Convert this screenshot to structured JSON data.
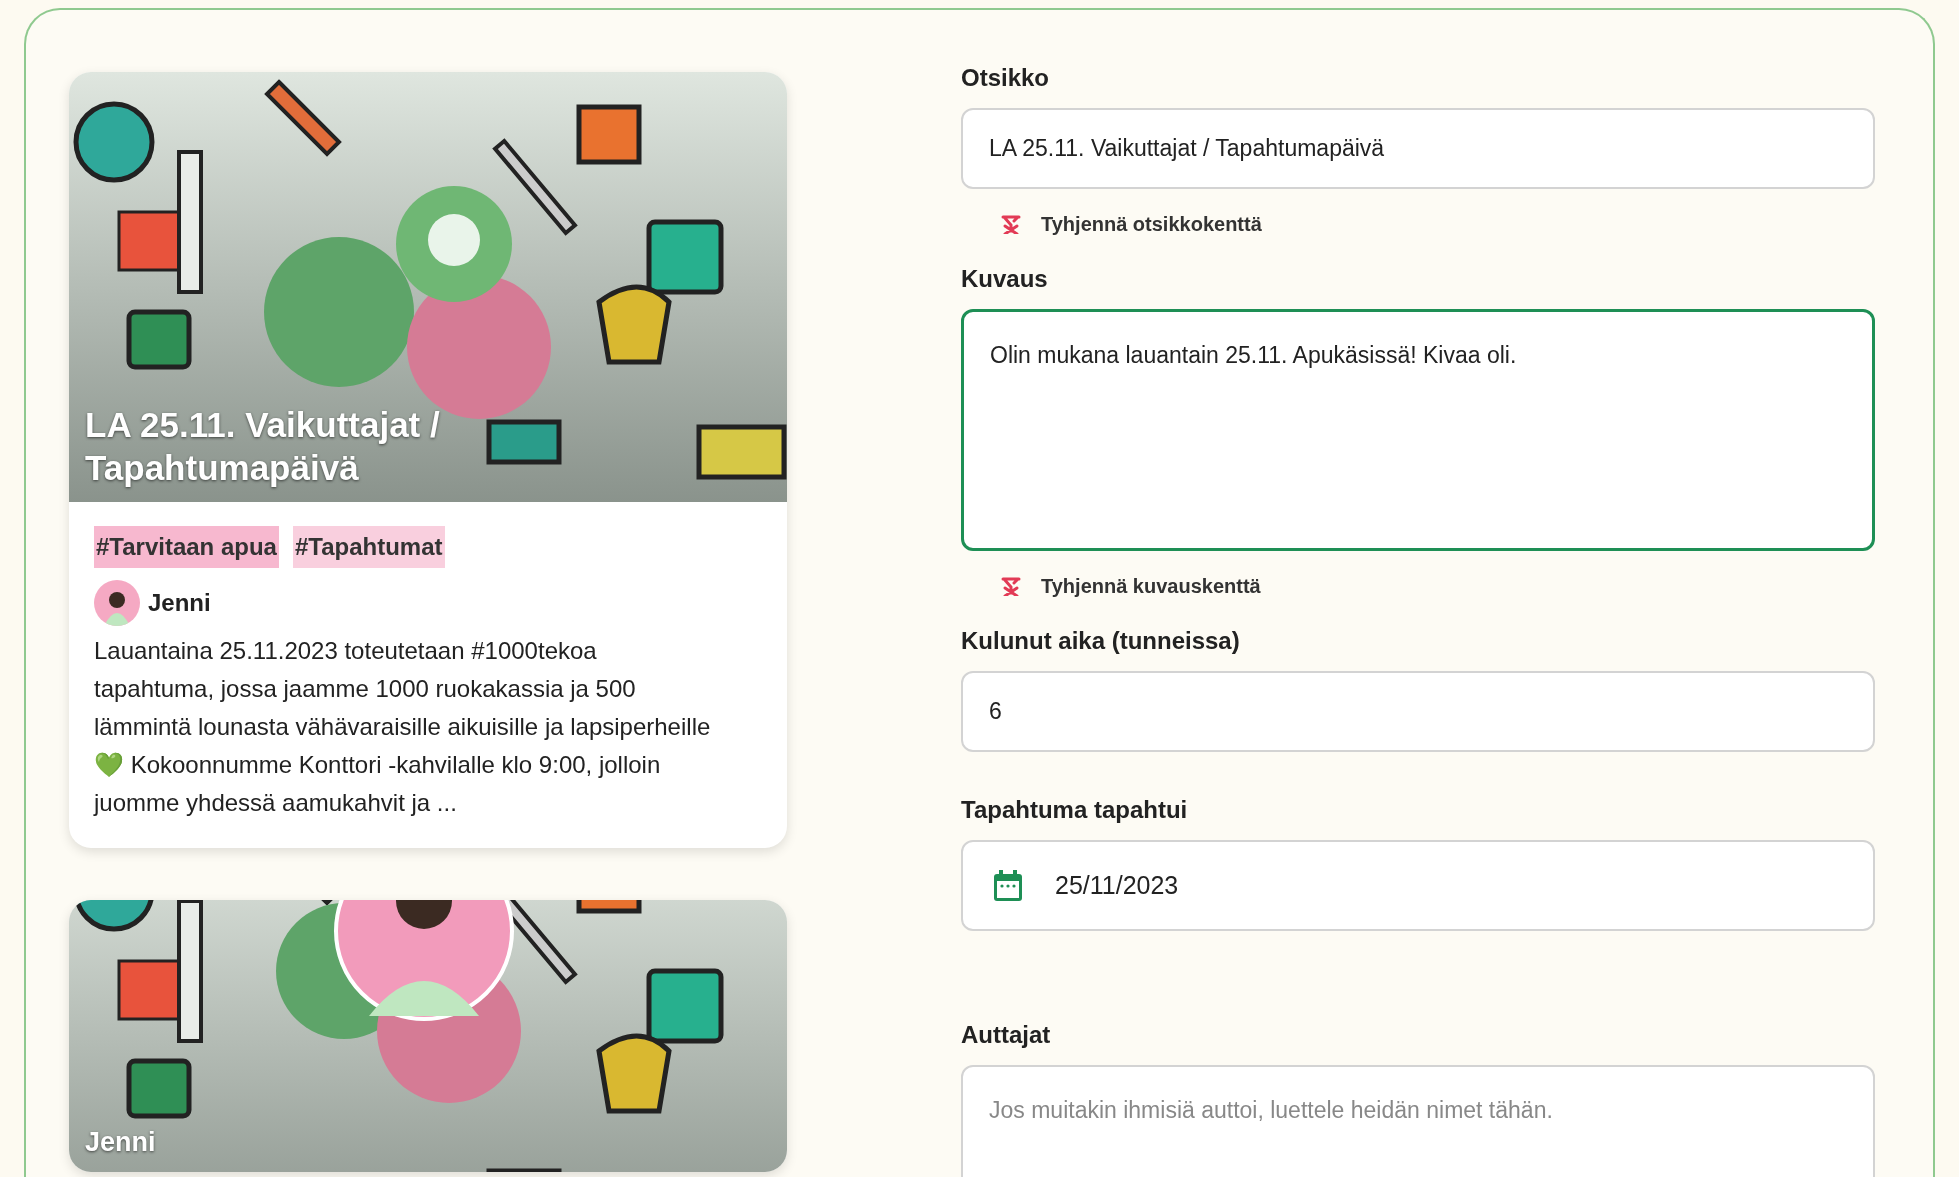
{
  "cards": [
    {
      "kind": "post",
      "title": "LA 25.11. Vaikuttajat / Tapahtumapäivä",
      "tags": [
        {
          "label": "#Tarvitaan apua",
          "color": "#f7b8cf"
        },
        {
          "label": "#Tapahtumat",
          "color": "#f9cfde"
        }
      ],
      "author": "Jenni",
      "excerpt": "Lauantaina 25.11.2023 toteutetaan #1000tekoa tapahtuma, jossa jaamme 1000 ruokakassia ja 500 lämmintä lounasta vähävaraisille aikuisille ja lapsiperheille 💚 Kokoonnumme Konttori -kahvilalle klo 9:00, jolloin juomme yhdessä aamukahvit ja ..."
    },
    {
      "kind": "profile",
      "title": "Jenni"
    }
  ],
  "form": [
    {
      "kind": "text",
      "label": "Otsikko",
      "value": "LA 25.11. Vaikuttajat / Tapahtumapäivä",
      "focused": false,
      "clear": "Tyhjennä otsikkokenttä"
    },
    {
      "kind": "textarea",
      "label": "Kuvaus",
      "value": "Olin mukana lauantain 25.11. Apukäsissä! Kivaa oli.",
      "focused": true,
      "clear": "Tyhjennä kuvauskenttä"
    },
    {
      "kind": "text",
      "label": "Kulunut aika (tunneissa)",
      "value": "6",
      "focused": false
    },
    {
      "kind": "date",
      "label": "Tapahtuma tapahtui",
      "value": "25/11/2023",
      "focused": false
    },
    {
      "kind": "textarea",
      "label": "Auttajat",
      "placeholder": "Jos muitakin ihmisiä auttoi, luettele heidän nimet tähän.",
      "focused": false
    }
  ]
}
